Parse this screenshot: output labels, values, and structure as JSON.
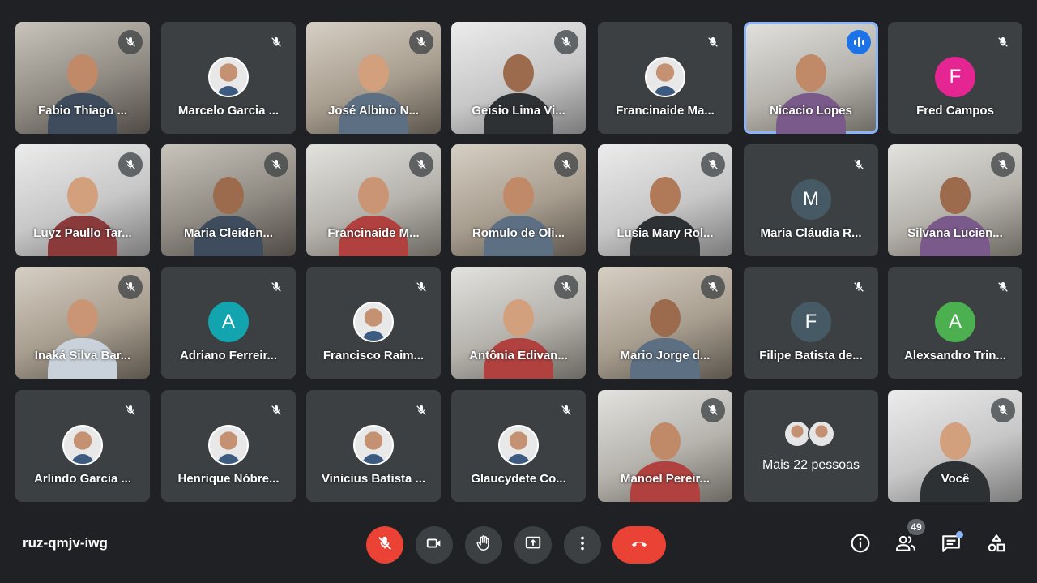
{
  "meeting_code": "ruz-qmjv-iwg",
  "participants_count": "49",
  "colors": {
    "background": "#202124",
    "tile": "#3c4043",
    "leave": "#ea4335",
    "accent": "#8ab4f8"
  },
  "tiles": [
    {
      "name": "Fabio Thiago ...",
      "kind": "video"
    },
    {
      "name": "Marcelo Garcia ...",
      "kind": "photo"
    },
    {
      "name": "José Albino N...",
      "kind": "video"
    },
    {
      "name": "Geisio Lima Vi...",
      "kind": "video"
    },
    {
      "name": "Francinaide Ma...",
      "kind": "photo"
    },
    {
      "name": "Nicacio Lopes",
      "kind": "video",
      "speaking": true
    },
    {
      "name": "Fred Campos",
      "kind": "letter",
      "letter": "F",
      "color": "#e52592"
    },
    {
      "name": "Luyz Paullo Tar...",
      "kind": "video"
    },
    {
      "name": "Maria Cleiden...",
      "kind": "video"
    },
    {
      "name": "Francinaide M...",
      "kind": "video"
    },
    {
      "name": "Romulo de Oli...",
      "kind": "video"
    },
    {
      "name": "Lusia Mary Rol...",
      "kind": "video"
    },
    {
      "name": "Maria Cláudia R...",
      "kind": "letter",
      "letter": "M",
      "color": "#455a64"
    },
    {
      "name": "Silvana Lucien...",
      "kind": "video"
    },
    {
      "name": "Inaká Silva Bar...",
      "kind": "video"
    },
    {
      "name": "Adriano Ferreir...",
      "kind": "letter",
      "letter": "A",
      "color": "#12a4af"
    },
    {
      "name": "Francisco Raim...",
      "kind": "photo"
    },
    {
      "name": "Antônia Edivan...",
      "kind": "video"
    },
    {
      "name": "Mario Jorge d...",
      "kind": "video"
    },
    {
      "name": "Filipe Batista de...",
      "kind": "letter",
      "letter": "F",
      "color": "#455a64"
    },
    {
      "name": "Alexsandro Trin...",
      "kind": "letter",
      "letter": "A",
      "color": "#4caf50"
    },
    {
      "name": "Arlindo Garcia ...",
      "kind": "photo"
    },
    {
      "name": "Henrique Nóbre...",
      "kind": "photo"
    },
    {
      "name": "Vinicius Batista ...",
      "kind": "photo"
    },
    {
      "name": "Glaucydete Co...",
      "kind": "photo"
    },
    {
      "name": "Manoel Pereir...",
      "kind": "video"
    },
    {
      "name": "Mais 22 pessoas",
      "kind": "more"
    },
    {
      "name": "Você",
      "kind": "video"
    }
  ],
  "controls": {
    "mic_icon": "mic-off-icon",
    "camera_icon": "videocam-icon",
    "raise_hand_icon": "hand-icon",
    "present_icon": "present-screen-icon",
    "more_icon": "more-vert-icon",
    "leave_icon": "call-end-icon",
    "info_icon": "info-icon",
    "people_icon": "people-icon",
    "chat_icon": "chat-icon",
    "activities_icon": "activities-icon"
  }
}
